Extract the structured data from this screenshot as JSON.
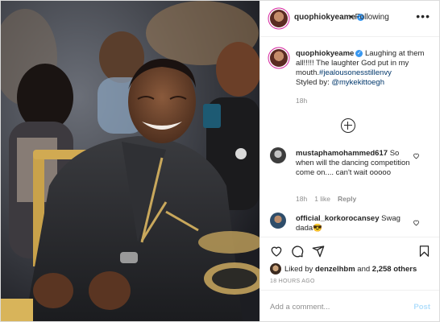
{
  "header": {
    "username": "quophiokyeame",
    "separator": "•",
    "follow_label": "Following",
    "more_icon": "more-dots-icon"
  },
  "caption": {
    "username": "quophiokyeame",
    "text": "Laughing at them all!!!!! The laughter God put in my mouth.",
    "hashtag": "#jealousonesstillenvy",
    "styled_prefix": "Styled by:",
    "styled_handle": "@mykekittoegh",
    "time": "18h"
  },
  "load_more_icon": "plus-circle-icon",
  "comments": [
    {
      "username": "mustaphamohammed617",
      "text": "So when will the dancing competition come on.... can't wait ooooo",
      "time": "18h",
      "likes": "1 like",
      "reply": "Reply"
    },
    {
      "username": "official_korkorocansey",
      "text": "Swag dada",
      "emoji": "😎"
    }
  ],
  "actions": {
    "icons": [
      "heart-icon",
      "comment-icon",
      "share-icon",
      "bookmark-icon"
    ],
    "liked_by_prefix": "Liked by",
    "liked_by_user": "denzelhbm",
    "liked_by_and": "and",
    "liked_by_count": "2,258 others",
    "timestamp": "18 HOURS AGO"
  },
  "add_comment": {
    "placeholder": "Add a comment...",
    "post_label": "Post"
  },
  "colors": {
    "link": "#00376b",
    "verified": "#3897f0",
    "muted": "#8e8e8e",
    "post_disabled": "#b2dffc"
  }
}
